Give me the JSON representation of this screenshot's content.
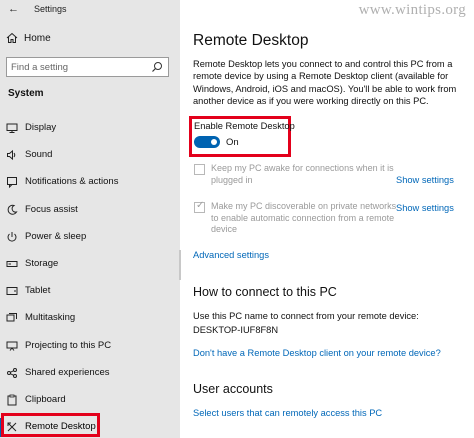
{
  "app": {
    "title": "Settings"
  },
  "sidebar": {
    "home_label": "Home",
    "search_placeholder": "Find a setting",
    "section_title": "System",
    "items": [
      {
        "label": "Display",
        "icon": "display-icon"
      },
      {
        "label": "Sound",
        "icon": "sound-icon"
      },
      {
        "label": "Notifications & actions",
        "icon": "notifications-icon"
      },
      {
        "label": "Focus assist",
        "icon": "moon-icon"
      },
      {
        "label": "Power & sleep",
        "icon": "power-icon"
      },
      {
        "label": "Storage",
        "icon": "storage-icon"
      },
      {
        "label": "Tablet",
        "icon": "tablet-icon"
      },
      {
        "label": "Multitasking",
        "icon": "multitasking-icon"
      },
      {
        "label": "Projecting to this PC",
        "icon": "projecting-icon"
      },
      {
        "label": "Shared experiences",
        "icon": "shared-icon"
      },
      {
        "label": "Clipboard",
        "icon": "clipboard-icon"
      },
      {
        "label": "Remote Desktop",
        "icon": "remote-desktop-icon",
        "selected": true
      }
    ]
  },
  "main": {
    "watermark": "www.wintips.org",
    "title": "Remote Desktop",
    "description": "Remote Desktop lets you connect to and control this PC from a remote device by using a Remote Desktop client (available for Windows, Android, iOS and macOS). You'll be able to work from another device as if you were working directly on this PC.",
    "enable": {
      "label": "Enable Remote Desktop",
      "state": "On",
      "on": true
    },
    "options": [
      {
        "text": "Keep my PC awake for connections when it is plugged in",
        "checked": false,
        "link": "Show settings"
      },
      {
        "text": "Make my PC discoverable on private networks to enable automatic connection from a remote device",
        "checked": true,
        "link": "Show settings"
      }
    ],
    "advanced_link": "Advanced settings",
    "connect": {
      "heading": "How to connect to this PC",
      "instruction": "Use this PC name to connect from your remote device:",
      "pc_name": "DESKTOP-IUF8F8N",
      "client_link": "Don't have a Remote Desktop client on your remote device?"
    },
    "accounts": {
      "heading": "User accounts",
      "link": "Select users that can remotely access this PC"
    }
  },
  "colors": {
    "accent": "#0063b1",
    "link": "#0067b8",
    "highlight": "#e3001b",
    "sidebar_bg": "#e6e6e6"
  }
}
